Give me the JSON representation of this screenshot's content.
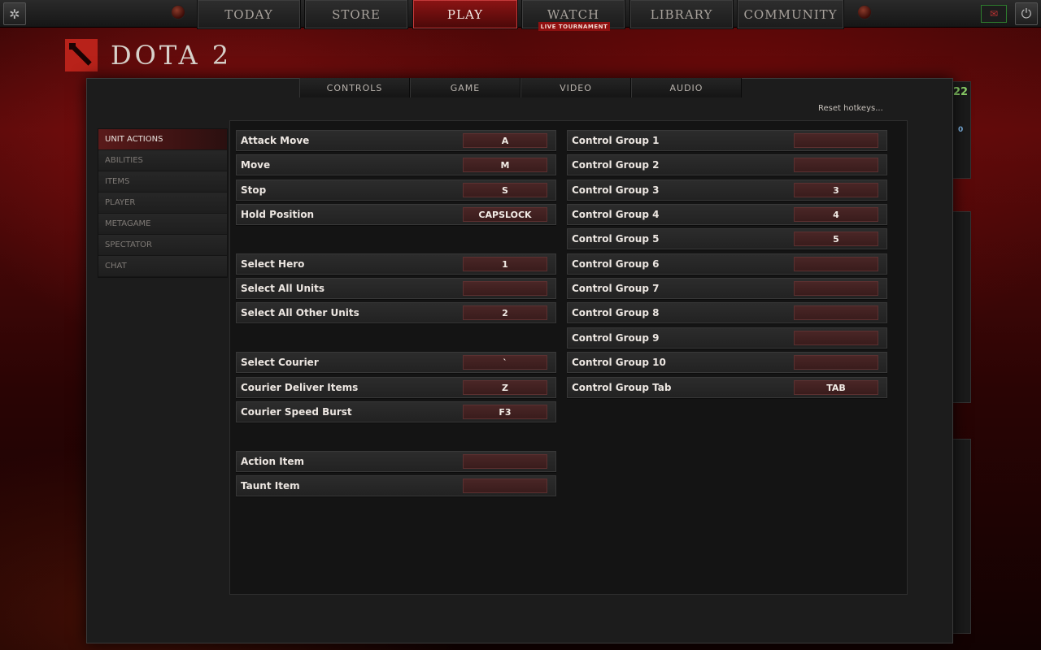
{
  "topnav": {
    "items": [
      {
        "label": "TODAY"
      },
      {
        "label": "STORE"
      },
      {
        "label": "PLAY"
      },
      {
        "label": "WATCH"
      },
      {
        "label": "LIBRARY"
      },
      {
        "label": "COMMUNITY"
      }
    ],
    "live_badge": "LIVE TOURNAMENT"
  },
  "logo": {
    "text": "DOTA 2"
  },
  "tabs": [
    {
      "label": "CONTROLS"
    },
    {
      "label": "GAME"
    },
    {
      "label": "VIDEO"
    },
    {
      "label": "AUDIO"
    }
  ],
  "reset_label": "Reset hotkeys...",
  "categories": [
    {
      "label": "UNIT ACTIONS"
    },
    {
      "label": "ABILITIES"
    },
    {
      "label": "ITEMS"
    },
    {
      "label": "PLAYER"
    },
    {
      "label": "METAGAME"
    },
    {
      "label": "SPECTATOR"
    },
    {
      "label": "CHAT"
    }
  ],
  "left_bindings": [
    {
      "label": "Attack Move",
      "key": "A"
    },
    {
      "label": "Move",
      "key": "M"
    },
    {
      "label": "Stop",
      "key": "S"
    },
    {
      "label": "Hold Position",
      "key": "CAPSLOCK"
    },
    {
      "label": "Select Hero",
      "key": "1"
    },
    {
      "label": "Select All Units",
      "key": ""
    },
    {
      "label": "Select All Other Units",
      "key": "2"
    },
    {
      "label": "Select Courier",
      "key": "`"
    },
    {
      "label": "Courier Deliver Items",
      "key": "Z"
    },
    {
      "label": "Courier Speed Burst",
      "key": "F3"
    },
    {
      "label": "Action Item",
      "key": ""
    },
    {
      "label": "Taunt Item",
      "key": ""
    }
  ],
  "right_bindings": [
    {
      "label": "Control Group 1",
      "key": ""
    },
    {
      "label": "Control Group 2",
      "key": ""
    },
    {
      "label": "Control Group 3",
      "key": "3"
    },
    {
      "label": "Control Group 4",
      "key": "4"
    },
    {
      "label": "Control Group 5",
      "key": "5"
    },
    {
      "label": "Control Group 6",
      "key": ""
    },
    {
      "label": "Control Group 7",
      "key": ""
    },
    {
      "label": "Control Group 8",
      "key": ""
    },
    {
      "label": "Control Group 9",
      "key": ""
    },
    {
      "label": "Control Group 10",
      "key": ""
    },
    {
      "label": "Control Group Tab",
      "key": "TAB"
    }
  ],
  "side": {
    "green_count": "22",
    "blue_count": "0"
  },
  "icons": {
    "settings": "gear-icon",
    "mail": "mail-icon",
    "power": "power-icon"
  }
}
